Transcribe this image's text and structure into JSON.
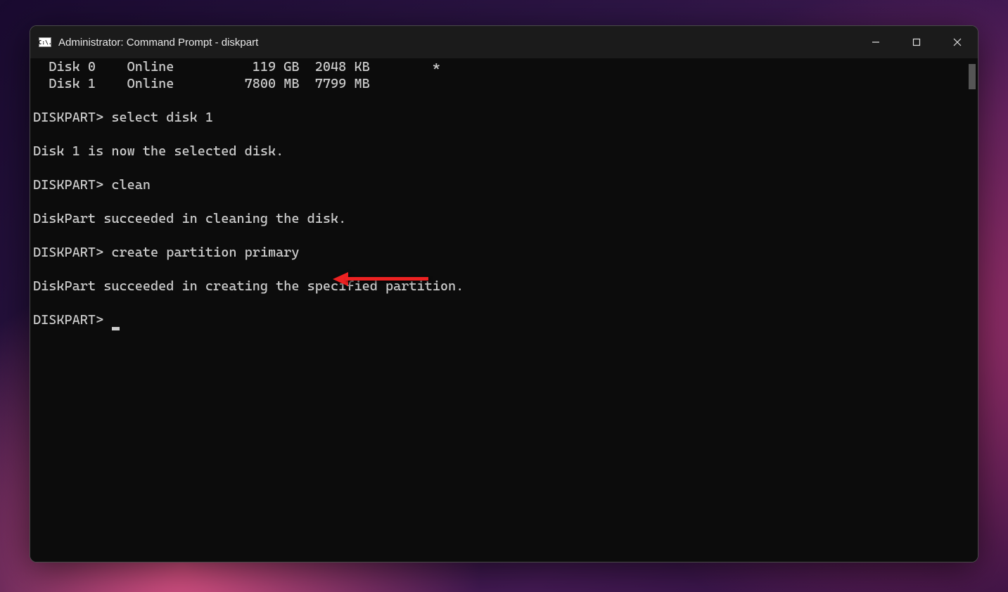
{
  "window": {
    "title": "Administrator: Command Prompt - diskpart",
    "icon_text": "C:\\."
  },
  "terminal": {
    "lines": [
      "  Disk 0    Online          119 GB  2048 KB        *",
      "  Disk 1    Online         7800 MB  7799 MB",
      "",
      "DISKPART> select disk 1",
      "",
      "Disk 1 is now the selected disk.",
      "",
      "DISKPART> clean",
      "",
      "DiskPart succeeded in cleaning the disk.",
      "",
      "DISKPART> create partition primary",
      "",
      "DiskPart succeeded in creating the specified partition.",
      "",
      "DISKPART> "
    ],
    "prompt": "DISKPART>",
    "cursor_line_index": 15
  },
  "annotation": {
    "type": "arrow",
    "color": "#e22",
    "points_to": "create partition primary"
  }
}
